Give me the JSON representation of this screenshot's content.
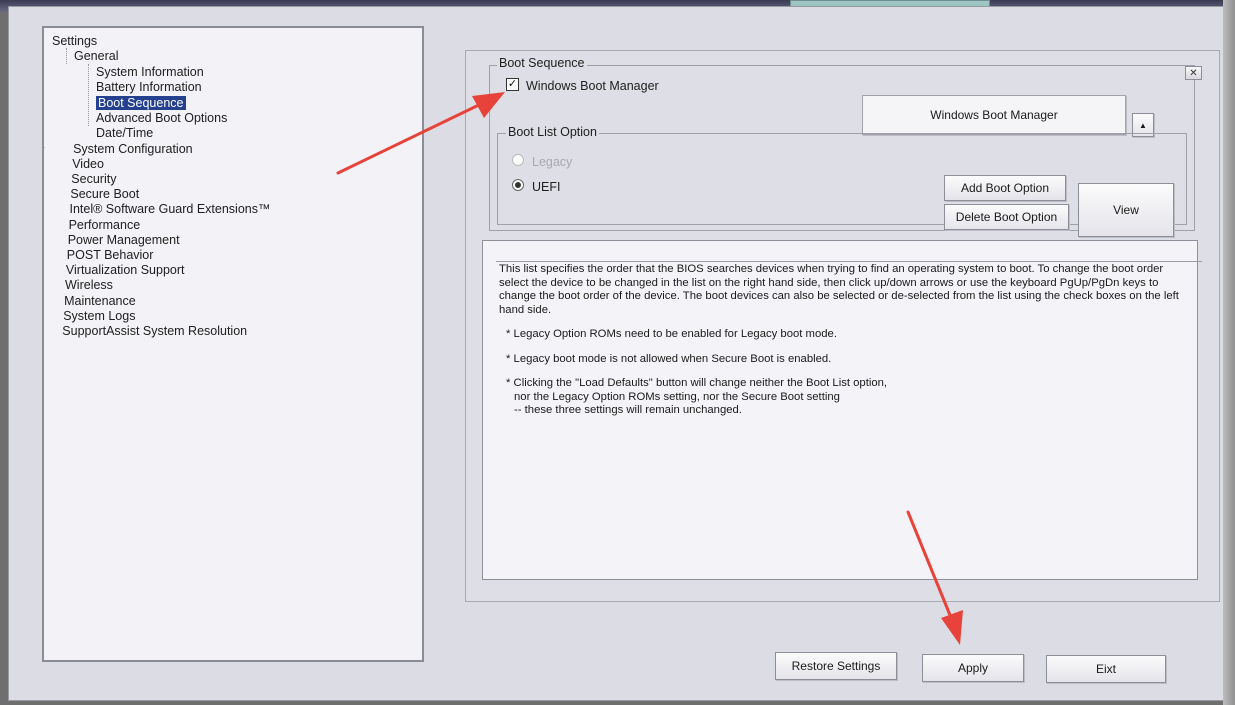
{
  "tree": {
    "items": [
      {
        "label": "Settings",
        "level": 0,
        "expander": false
      },
      {
        "label": "General",
        "level": 1,
        "expander": false
      },
      {
        "label": "System Information",
        "level": 2,
        "expander": false
      },
      {
        "label": "Battery Information",
        "level": 2,
        "expander": false
      },
      {
        "label": "Boot Sequence",
        "level": 2,
        "expander": false,
        "selected": true
      },
      {
        "label": "Advanced Boot Options",
        "level": 2,
        "expander": false
      },
      {
        "label": "Date/Time",
        "level": 2,
        "expander": false
      },
      {
        "label": "System Configuration",
        "level": 1,
        "expander": true
      },
      {
        "label": "Video",
        "level": 1,
        "expander": true
      },
      {
        "label": "Security",
        "level": 1,
        "expander": true
      },
      {
        "label": "Secure Boot",
        "level": 1,
        "expander": true
      },
      {
        "label": "Intel® Software Guard Extensions™",
        "level": 1,
        "expander": true
      },
      {
        "label": "Performance",
        "level": 1,
        "expander": true
      },
      {
        "label": "Power Management",
        "level": 1,
        "expander": true
      },
      {
        "label": "POST Behavior",
        "level": 1,
        "expander": true
      },
      {
        "label": "Virtualization Support",
        "level": 1,
        "expander": true
      },
      {
        "label": "Wireless",
        "level": 1,
        "expander": true
      },
      {
        "label": "Maintenance",
        "level": 1,
        "expander": true
      },
      {
        "label": "System Logs",
        "level": 1,
        "expander": true
      },
      {
        "label": "SupportAssist System Resolution",
        "level": 1,
        "expander": true
      }
    ]
  },
  "boot_sequence": {
    "title": "Boot Sequence",
    "entry_label": "Windows Boot Manager",
    "entry_checked": true,
    "selected_device": "Windows Boot Manager",
    "up_arrow": "▲",
    "close_glyph": "✕"
  },
  "boot_list_option": {
    "title": "Boot List Option",
    "options": [
      {
        "label": "Legacy",
        "checked": false,
        "disabled": true
      },
      {
        "label": "UEFI",
        "checked": true,
        "disabled": false
      }
    ],
    "add_button": "Add Boot Option",
    "delete_button": "Delete Boot Option",
    "view_button": "View"
  },
  "description": {
    "intro": "This list specifies the order that the BIOS searches devices when trying to find an operating system to boot. To change the boot order select the device to be changed in the list on the right hand side, then click up/down arrows or use the keyboard PgUp/PgDn keys to change the boot order of the device. The boot devices can also be selected or de-selected from the list using the check boxes on the left hand side.",
    "bullet1": "* Legacy Option ROMs need to be enabled for Legacy boot mode.",
    "bullet2": "* Legacy boot mode is not allowed when Secure Boot is enabled.",
    "bullet3_line1": "* Clicking the \"Load Defaults\" button will change neither the Boot List option,",
    "bullet3_line2": "nor the Legacy Option ROMs setting, nor the Secure Boot setting",
    "bullet3_line3": "-- these three settings will remain unchanged."
  },
  "footer": {
    "restore_button": "Restore Settings",
    "apply_button": "Apply",
    "exit_button": "Eixt"
  },
  "annotation_color": "#e8433a"
}
